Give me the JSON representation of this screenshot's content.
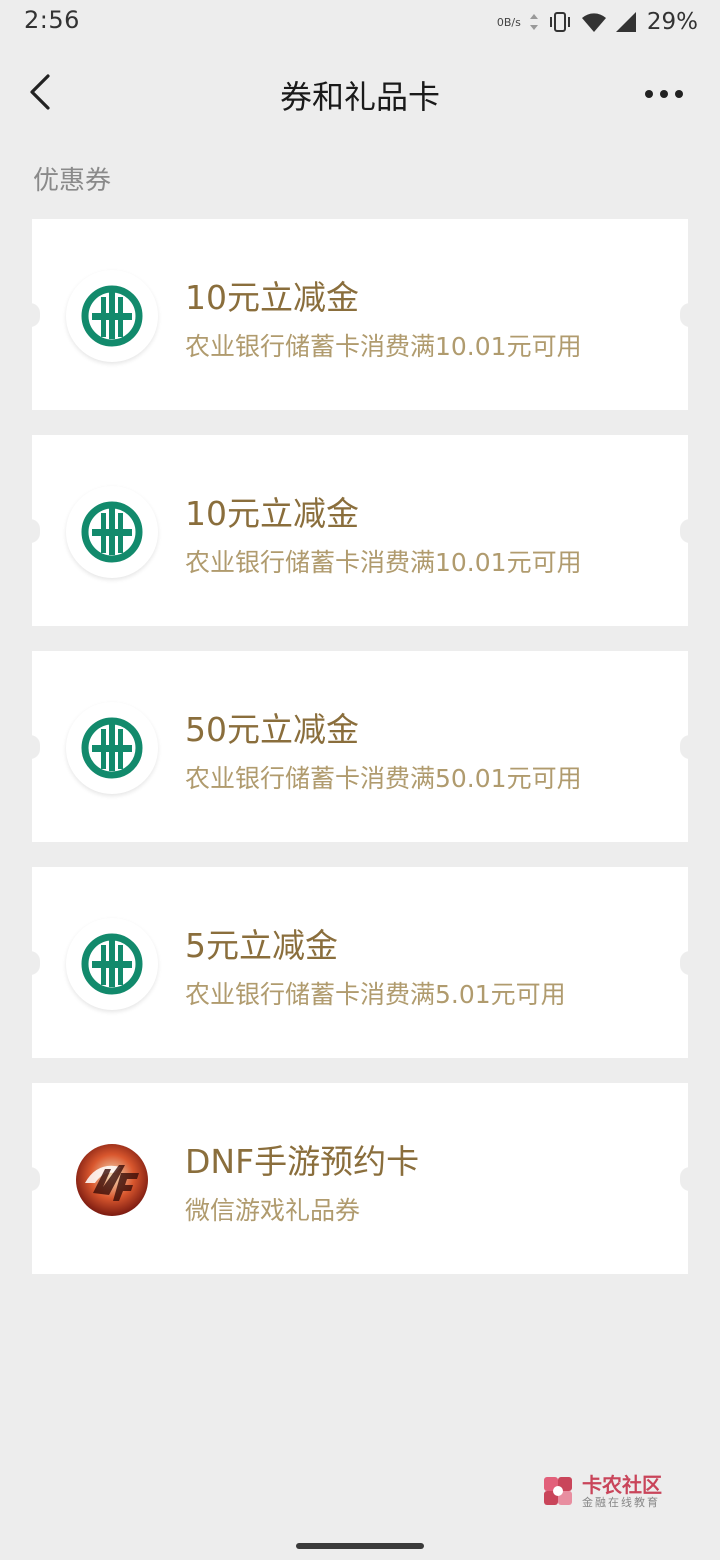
{
  "status": {
    "time": "2:56",
    "net_speed": "0B/s",
    "battery": "29%"
  },
  "nav": {
    "title": "券和礼品卡"
  },
  "section": {
    "label": "优惠券"
  },
  "colors": {
    "bank_green": "#128a6c",
    "title_gold": "#8a6e3c",
    "sub_gold": "#b09b6e",
    "dnf_red": "#c8321e"
  },
  "cards": [
    {
      "icon": "abc-bank-logo-icon",
      "title": "10元立减金",
      "subtitle": "农业银行储蓄卡消费满10.01元可用"
    },
    {
      "icon": "abc-bank-logo-icon",
      "title": "10元立减金",
      "subtitle": "农业银行储蓄卡消费满10.01元可用"
    },
    {
      "icon": "abc-bank-logo-icon",
      "title": "50元立减金",
      "subtitle": "农业银行储蓄卡消费满50.01元可用"
    },
    {
      "icon": "abc-bank-logo-icon",
      "title": "5元立减金",
      "subtitle": "农业银行储蓄卡消费满5.01元可用"
    },
    {
      "icon": "dnf-game-logo-icon",
      "title": "DNF手游预约卡",
      "subtitle": "微信游戏礼品券"
    }
  ],
  "watermark": {
    "main": "卡农社区",
    "sub": "金融在线教育"
  }
}
